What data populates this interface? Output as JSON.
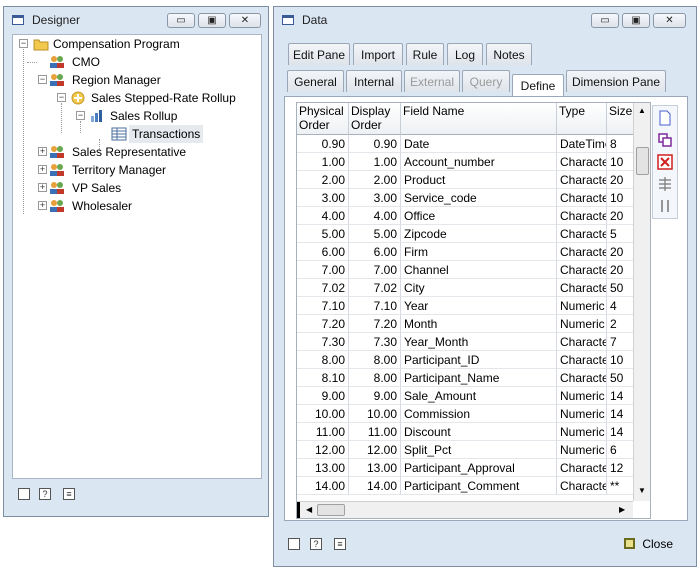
{
  "designer": {
    "title": "Designer",
    "tree": [
      {
        "label": "Compensation Program"
      },
      {
        "label": "CMO"
      },
      {
        "label": "Region Manager"
      },
      {
        "label": "Sales Stepped-Rate Rollup"
      },
      {
        "label": "Sales Rollup"
      },
      {
        "label": "Transactions"
      },
      {
        "label": "Sales Representative"
      },
      {
        "label": "Territory Manager"
      },
      {
        "label": "VP Sales"
      },
      {
        "label": "Wholesaler"
      }
    ]
  },
  "data_window": {
    "title": "Data",
    "tabs_row1": [
      "Edit Pane",
      "Import",
      "Rule",
      "Log",
      "Notes"
    ],
    "tabs_row2": [
      "General",
      "Internal",
      "External",
      "Query",
      "Define",
      "Dimension Pane"
    ],
    "active_tab": "Define",
    "columns": [
      "Physical Order",
      "Display Order",
      "Field Name",
      "Type",
      "Size"
    ],
    "rows": [
      [
        "0.90",
        "0.90",
        "Date",
        "DateTime",
        "8"
      ],
      [
        "1.00",
        "1.00",
        "Account_number",
        "Characte",
        "10"
      ],
      [
        "2.00",
        "2.00",
        "Product",
        "Characte",
        "20"
      ],
      [
        "3.00",
        "3.00",
        "Service_code",
        "Characte",
        "10"
      ],
      [
        "4.00",
        "4.00",
        "Office",
        "Characte",
        "20"
      ],
      [
        "5.00",
        "5.00",
        "Zipcode",
        "Characte",
        "5"
      ],
      [
        "6.00",
        "6.00",
        "Firm",
        "Characte",
        "20"
      ],
      [
        "7.00",
        "7.00",
        "Channel",
        "Characte",
        "20"
      ],
      [
        "7.02",
        "7.02",
        "City",
        "Characte",
        "50"
      ],
      [
        "7.10",
        "7.10",
        "Year",
        "Numeric",
        "4"
      ],
      [
        "7.20",
        "7.20",
        "Month",
        "Numeric",
        "2"
      ],
      [
        "7.30",
        "7.30",
        "Year_Month",
        "Characte",
        "7"
      ],
      [
        "8.00",
        "8.00",
        "Participant_ID",
        "Characte",
        "10"
      ],
      [
        "8.10",
        "8.00",
        "Participant_Name",
        "Characte",
        "50"
      ],
      [
        "9.00",
        "9.00",
        "Sale_Amount",
        "Numeric",
        "14"
      ],
      [
        "10.00",
        "10.00",
        "Commission",
        "Numeric",
        "14"
      ],
      [
        "11.00",
        "11.00",
        "Discount",
        "Numeric",
        "14"
      ],
      [
        "12.00",
        "12.00",
        "Split_Pct",
        "Numeric",
        "6"
      ],
      [
        "13.00",
        "13.00",
        "Participant_Approval",
        "Characte",
        "12"
      ],
      [
        "14.00",
        "14.00",
        "Participant_Comment",
        "Characte",
        "**"
      ]
    ],
    "close_label": "Close"
  }
}
